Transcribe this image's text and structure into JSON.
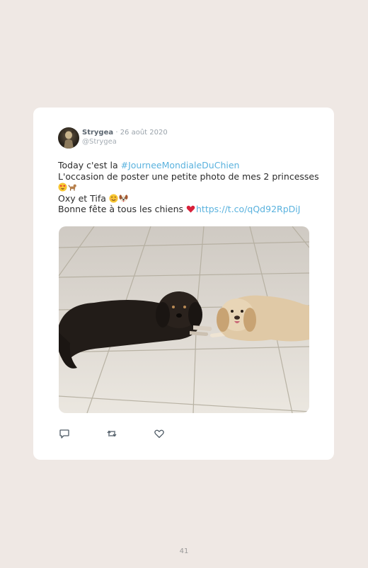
{
  "tweet": {
    "author_name": "Strygea",
    "separator": "·",
    "date": "26 août 2020",
    "handle": "@Strygea",
    "line1_prefix": "Today c'est la ",
    "hashtag": "#JourneeMondialeDuChien",
    "line2": "L'occasion de poster une petite photo de mes 2 princesses",
    "line3": "Oxy et Tifa ",
    "line4_prefix": "Bonne fête à tous les chiens ",
    "link": "https://t.co/qQd92RpDiJ",
    "emojis": [
      "heart-eyes-emoji",
      "dog-emoji",
      "smiling-face-emoji",
      "dog-face-emoji",
      "red-heart-emoji"
    ],
    "photo_subject": "two dogs lying on a tiled floor"
  },
  "actions": [
    "reply-icon",
    "retweet-icon",
    "like-icon"
  ],
  "footer": {
    "page_number": "41"
  }
}
